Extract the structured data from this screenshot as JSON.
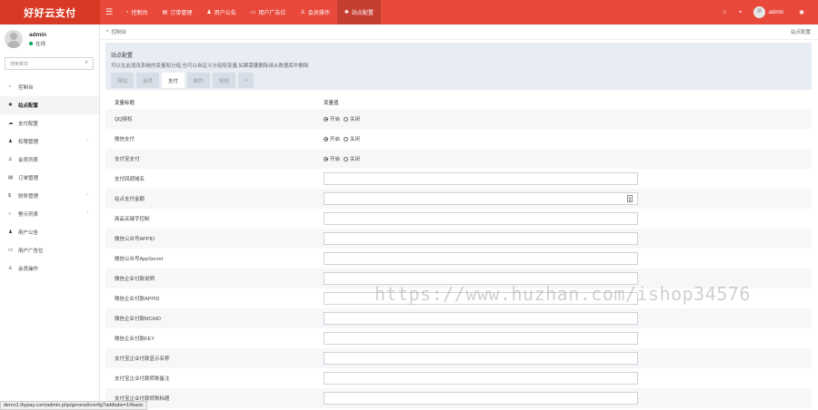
{
  "app": {
    "logo": "好好云支付"
  },
  "topnav": {
    "items": [
      {
        "icon": "dashboard-icon",
        "label": "控制台"
      },
      {
        "icon": "order-icon",
        "label": "订单管理"
      },
      {
        "icon": "bell-icon",
        "label": "用户公告"
      },
      {
        "icon": "card-icon",
        "label": "用户广告位"
      },
      {
        "icon": "user-icon",
        "label": "会员操作"
      },
      {
        "icon": "gear-icon",
        "label": "站点配置",
        "active": true
      }
    ],
    "username": "admin"
  },
  "sidebar": {
    "user": {
      "name": "admin",
      "status": "在线"
    },
    "search_placeholder": "搜索菜单",
    "items": [
      {
        "icon": "dashboard-icon",
        "label": "控制台"
      },
      {
        "icon": "gear-icon",
        "label": "站点配置",
        "active": true
      },
      {
        "icon": "cloud-icon",
        "label": "支付配置"
      },
      {
        "icon": "users-icon",
        "label": "权限管理",
        "arrow": true
      },
      {
        "icon": "user-icon",
        "label": "会员列表"
      },
      {
        "icon": "order-icon",
        "label": "订单管理"
      },
      {
        "icon": "dollar-icon",
        "label": "财务管理",
        "arrow": true
      },
      {
        "icon": "circle-icon",
        "label": "警示列表",
        "arrow": true
      },
      {
        "icon": "bell-icon",
        "label": "用户公告"
      },
      {
        "icon": "card-icon",
        "label": "用户广告位"
      },
      {
        "icon": "user-icon",
        "label": "会员操作"
      }
    ]
  },
  "breadcrumb": {
    "current": "控制台",
    "right": "站点配置"
  },
  "panel": {
    "title": "站点配置",
    "description": "可以在此增改系统的变量和分组,也可以自定义分组和变量,如果需要删除请从数据库中删除",
    "tabs": [
      "网站",
      "会员",
      "支付",
      "邮件",
      "短信",
      "+"
    ],
    "active_tab": 2
  },
  "table": {
    "headers": [
      "变量标题",
      "变量值"
    ],
    "rows": [
      {
        "label": "QQ授权",
        "type": "radio",
        "options": [
          "开启",
          "关闭"
        ],
        "selected": 0
      },
      {
        "label": "微信支付",
        "type": "radio",
        "options": [
          "开启",
          "关闭"
        ],
        "selected": 0
      },
      {
        "label": "支付宝支付",
        "type": "radio",
        "options": [
          "开启",
          "关闭"
        ],
        "selected": 0
      },
      {
        "label": "支付回调域名",
        "type": "input",
        "value": ""
      },
      {
        "label": "站点支付金额",
        "type": "number",
        "value": ""
      },
      {
        "label": "商品关键字控制",
        "type": "input",
        "value": ""
      },
      {
        "label": "微信公众号APPID",
        "type": "input",
        "value": ""
      },
      {
        "label": "微信公众号AppSecret",
        "type": "input",
        "value": ""
      },
      {
        "label": "微信企业付款说明",
        "type": "input",
        "value": ""
      },
      {
        "label": "微信企业付款APPID",
        "type": "input",
        "value": ""
      },
      {
        "label": "微信企业付款MCHID",
        "type": "input",
        "value": ""
      },
      {
        "label": "微信企业付款KEY",
        "type": "input",
        "value": ""
      },
      {
        "label": "支付宝企业付款显示名称",
        "type": "input",
        "value": ""
      },
      {
        "label": "支付宝企业付款转账备注",
        "type": "input",
        "value": ""
      },
      {
        "label": "支付宝企业付款转账标题",
        "type": "input",
        "value": ""
      }
    ]
  },
  "watermark": "https://www.huzhan.com/ishop34576",
  "statusbar": "demo1.lhypay.com/admin.php/general/config?addtabs=1#basic"
}
